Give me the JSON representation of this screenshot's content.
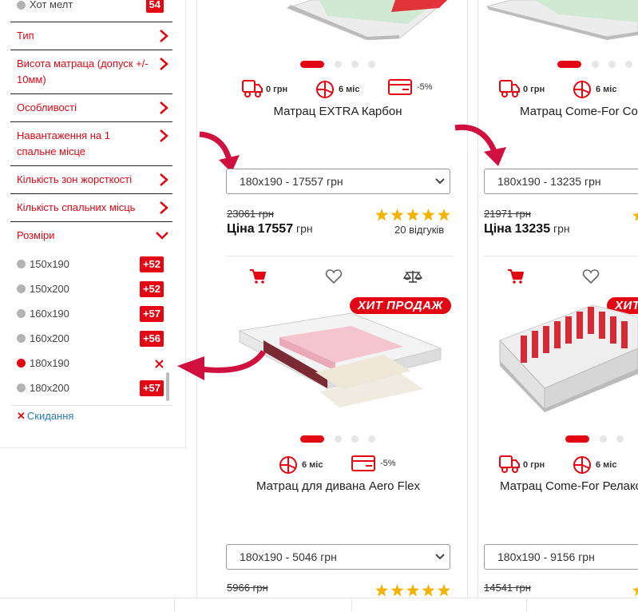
{
  "filters": {
    "hot_option": {
      "label": "Хот мелт",
      "count": "54"
    },
    "groups": [
      {
        "label": "Тип"
      },
      {
        "label": "Висота матраца (допуск +/- 10мм)"
      },
      {
        "label": "Особливості"
      },
      {
        "label": "Навантаження на 1 спальне місце"
      },
      {
        "label": "Кількість зон жорсткості"
      },
      {
        "label": "Кількість спальних місць"
      },
      {
        "label": "Розміри"
      }
    ],
    "sizes": [
      {
        "label": "150x190",
        "count": "+52"
      },
      {
        "label": "150x200",
        "count": "+52"
      },
      {
        "label": "160x190",
        "count": "+57"
      },
      {
        "label": "160x200",
        "count": "+56"
      },
      {
        "label": "180x190",
        "count": "",
        "active": true
      },
      {
        "label": "180x200",
        "count": "+57"
      }
    ],
    "reset_label": "Скидання"
  },
  "products": [
    {
      "name": "Матрац EXTRA Карбон",
      "features": {
        "delivery": "0 грн",
        "installments": "6 міс",
        "discount": "-5%"
      },
      "size_select": "180x190 - 17557 грн",
      "old_price": "23061 грн",
      "price_label": "Ціна",
      "price_value": "17557",
      "currency": "грн",
      "rating": 5,
      "reviews": "20 відгуків"
    },
    {
      "name": "Матрац Come-For Coo",
      "features": {
        "delivery": "0 грн",
        "installments": "6 міс"
      },
      "size_select": "180x190 - 13235 грн",
      "old_price": "21971 грн",
      "price_label": "Ціна",
      "price_value": "13235",
      "currency": "грн"
    },
    {
      "badge": "ХИТ ПРОДАЖ",
      "name": "Матрац для дивана Aero Flex",
      "features": {
        "installments": "6 міс",
        "discount": "-5%"
      },
      "size_select": "180x190 - 5046 грн",
      "old_price": "5966 грн",
      "rating": 5
    },
    {
      "badge": "ХИТ",
      "name": "Матрац Come-For Релакс",
      "features": {
        "delivery": "0 грн",
        "installments": "6 міс"
      },
      "size_select": "180x190 - 9156 грн",
      "old_price": "14541 грн"
    }
  ],
  "colors": {
    "accent": "#e30613",
    "link": "#2a7ab8",
    "star": "#f5b301"
  }
}
